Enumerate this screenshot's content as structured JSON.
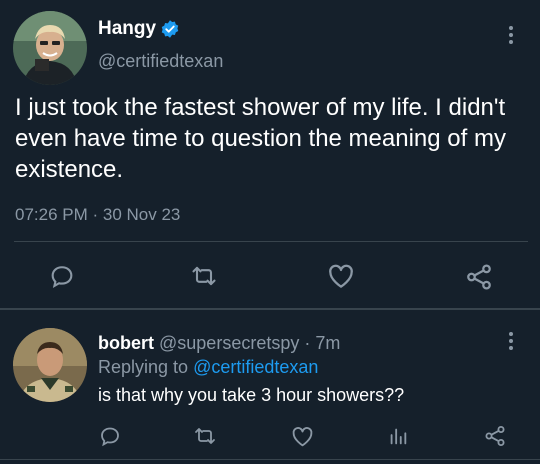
{
  "tweet": {
    "display_name": "Hangy",
    "verified": true,
    "handle": "@certifiedtexan",
    "text": "I just took the fastest shower of my life. I didn't even have time to question the meaning of my existence.",
    "timestamp": "07:26 PM · 30 Nov 23"
  },
  "reply": {
    "display_name": "bobert",
    "handle": "@supersecretspy",
    "separator": " · ",
    "time_ago": "7m",
    "replying_prefix": "Replying to ",
    "replying_to": "@certifiedtexan",
    "text": "is that why you take 3 hour showers??"
  },
  "icons": {
    "main_actions": [
      "reply-icon",
      "retweet-icon",
      "like-icon",
      "share-icon"
    ],
    "reply_actions": [
      "reply-icon",
      "retweet-icon",
      "like-icon",
      "analytics-icon",
      "share-icon"
    ],
    "more": "more-vertical-icon",
    "verified": "verified-badge-icon"
  },
  "colors": {
    "background": "#15202b",
    "text": "#ffffff",
    "secondary_text": "#8b98a5",
    "accent": "#1d9bf0",
    "divider": "#38444d"
  }
}
